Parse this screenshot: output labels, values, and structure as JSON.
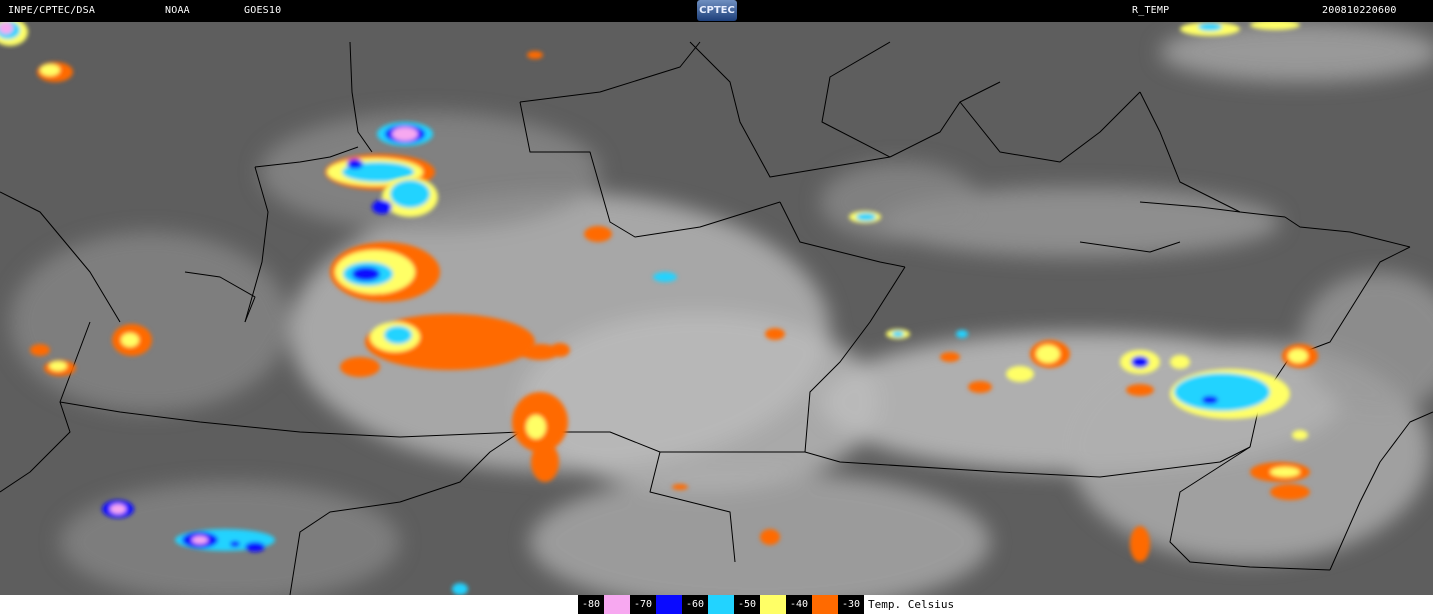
{
  "header": {
    "source": "INPE/CPTEC/DSA",
    "agency": "NOAA",
    "satellite": "GOES10",
    "logo_text": "CPTEC",
    "product": "R_TEMP",
    "timestamp": "200810220600"
  },
  "legend": {
    "items": [
      {
        "label": "-80",
        "color": "#f7a8f0"
      },
      {
        "label": "-70",
        "color": "#0a0aff"
      },
      {
        "label": "-60",
        "color": "#22d3ff"
      },
      {
        "label": "-50",
        "color": "#ffff66"
      },
      {
        "label": "-40",
        "color": "#ff6a00"
      },
      {
        "label": "-30",
        "color": null
      }
    ],
    "title": "Temp. Celsius"
  },
  "map_colors": {
    "background": "#5e5e5e",
    "clouds": "#b4b4b4",
    "borders": "#000000"
  }
}
